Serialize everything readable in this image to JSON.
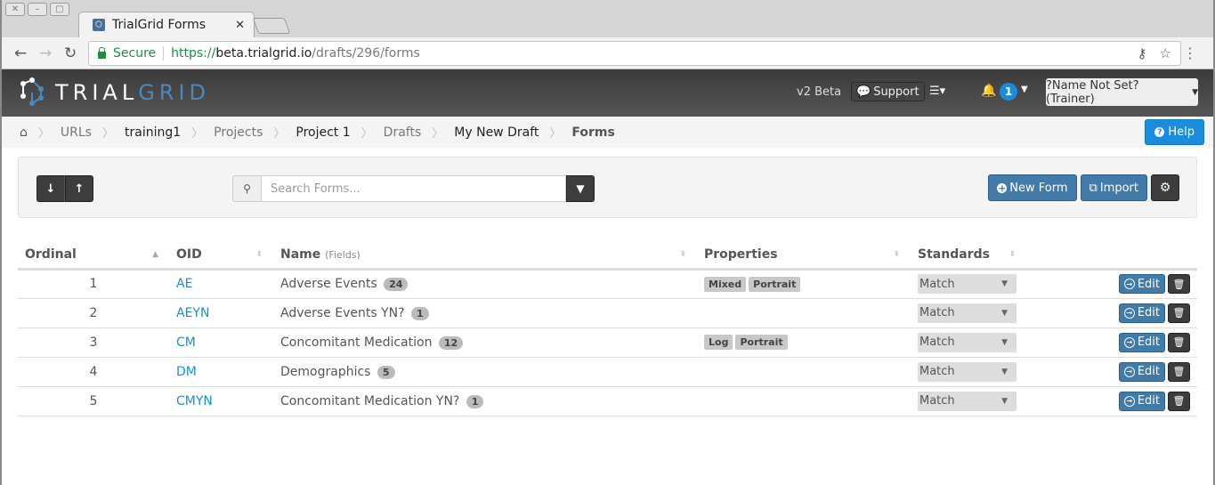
{
  "browser": {
    "tab_title": "TrialGrid Forms",
    "secure_label": "Secure",
    "url_scheme": "https://",
    "url_host": "beta.trialgrid.io",
    "url_path": "/drafts/296/forms"
  },
  "app": {
    "logo_left": "TRIAL",
    "logo_right": "GRID",
    "version_label": "v2 Beta",
    "support_label": "Support",
    "notification_count": "1",
    "user_label": "?Name Not Set? (Trainer)",
    "help_label": "Help",
    "accent_color": "#1a8cdd",
    "primary_button_color": "#427aa9"
  },
  "breadcrumb": [
    {
      "label": "URLs"
    },
    {
      "label": "training1"
    },
    {
      "label": "Projects"
    },
    {
      "label": "Project 1"
    },
    {
      "label": "Drafts"
    },
    {
      "label": "My New Draft"
    },
    {
      "label": "Forms"
    }
  ],
  "toolbar": {
    "search_placeholder": "Search Forms...",
    "new_form_label": "New Form",
    "import_label": "Import"
  },
  "table": {
    "headers": {
      "ordinal": "Ordinal",
      "oid": "OID",
      "name": "Name",
      "name_sub": "(Fields)",
      "properties": "Properties",
      "standards": "Standards"
    },
    "edit_label": "Edit",
    "rows": [
      {
        "ordinal": "1",
        "oid": "AE",
        "name": "Adverse Events",
        "fields": "24",
        "properties": [
          "Mixed",
          "Portrait"
        ],
        "standards": "Match"
      },
      {
        "ordinal": "2",
        "oid": "AEYN",
        "name": "Adverse Events YN?",
        "fields": "1",
        "properties": [],
        "standards": "Match"
      },
      {
        "ordinal": "3",
        "oid": "CM",
        "name": "Concomitant Medication",
        "fields": "12",
        "properties": [
          "Log",
          "Portrait"
        ],
        "standards": "Match"
      },
      {
        "ordinal": "4",
        "oid": "DM",
        "name": "Demographics",
        "fields": "5",
        "properties": [],
        "standards": "Match"
      },
      {
        "ordinal": "5",
        "oid": "CMYN",
        "name": "Concomitant Medication YN?",
        "fields": "1",
        "properties": [],
        "standards": "Match"
      }
    ]
  }
}
